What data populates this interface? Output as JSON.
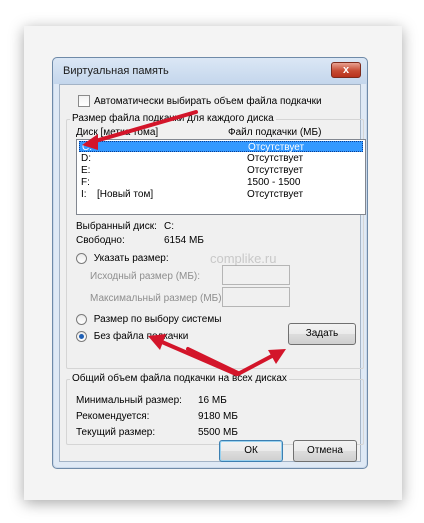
{
  "window": {
    "title": "Виртуальная память",
    "close_label": "x"
  },
  "auto_checkbox": {
    "label": "Автоматически выбирать объем файла подкачки",
    "checked": false
  },
  "paging_group": {
    "label": "Размер файла подкачки для каждого диска",
    "header_disk": "Диск [метка тома]",
    "header_file": "Файл подкачки (МБ)",
    "drives": [
      {
        "letter": "C:",
        "name": "",
        "paging": "Отсутствует",
        "selected": true
      },
      {
        "letter": "D:",
        "name": "",
        "paging": "Отсутствует",
        "selected": false
      },
      {
        "letter": "E:",
        "name": "",
        "paging": "Отсутствует",
        "selected": false
      },
      {
        "letter": "F:",
        "name": "",
        "paging": "1500 - 1500",
        "selected": false
      },
      {
        "letter": "I:",
        "name": "[Новый том]",
        "paging": "Отсутствует",
        "selected": false
      }
    ],
    "selected_disk_label": "Выбранный диск:",
    "selected_disk_value": "C:",
    "free_label": "Свободно:",
    "free_value": "6154 МБ",
    "custom_size_label": "Указать размер:",
    "initial_size_label": "Исходный размер (МБ):",
    "max_size_label": "Максимальный размер (МБ):",
    "system_managed_label": "Размер по выбору системы",
    "no_paging_label": "Без файла подкачки",
    "set_button": "Задать",
    "selected_option": "no_paging"
  },
  "total_group": {
    "label": "Общий объем файла подкачки на всех дисках",
    "min_label": "Минимальный размер:",
    "min_value": "16 МБ",
    "recommended_label": "Рекомендуется:",
    "recommended_value": "9180 МБ",
    "current_label": "Текущий размер:",
    "current_value": "5500 МБ"
  },
  "buttons": {
    "ok": "ОК",
    "cancel": "Отмена"
  },
  "watermark": "complike.ru",
  "colors": {
    "selection": "#3399ff",
    "arrow": "#d3152a"
  }
}
